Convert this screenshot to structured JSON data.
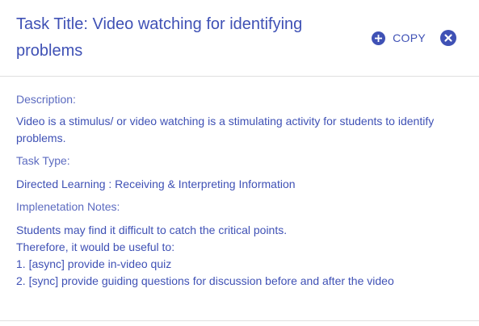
{
  "dialog": {
    "title": "Task Title: Video watching for identifying problems",
    "copy_label": "COPY",
    "copy_icon": "plus-circle-icon",
    "close_icon": "close-circle-icon"
  },
  "content": {
    "description_label": "Description:",
    "description_text": "Video is a stimulus/ or video watching is a stimulating activity for students to identify problems.",
    "task_type_label": "Task Type:",
    "task_type_value": "Directed Learning : Receiving & Interpreting Information",
    "notes_label": "Implenetation Notes:",
    "notes_lines": [
      "Students may find it difficult to catch the critical points.",
      "Therefore, it would be useful to:",
      "1. [async] provide in-video quiz",
      "2. [sync] provide guiding questions for discussion before and after the video"
    ]
  },
  "colors": {
    "accent": "#3f51b5",
    "divider": "#e0e0e0"
  }
}
